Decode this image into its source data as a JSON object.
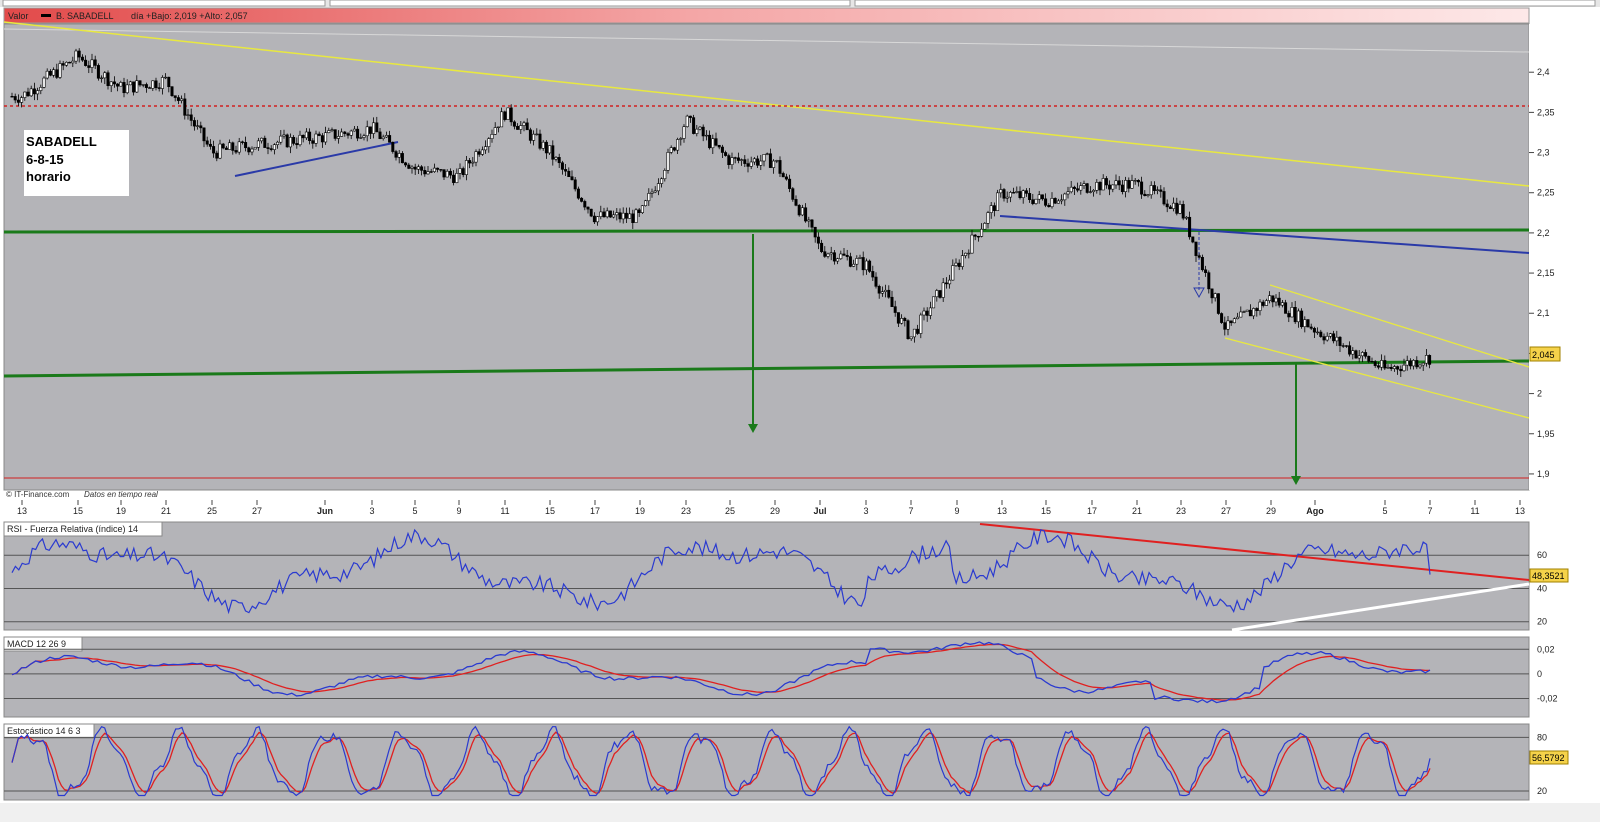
{
  "price_panel": {
    "header": {
      "series_label": "Valor",
      "instrument": "B. SABADELL",
      "stats": "día +Bajo: 2,019 +Alto: 2,057"
    },
    "annotation_lines": [
      "SABADELL",
      "6-8-15",
      "horario"
    ],
    "footer": {
      "source": "© IT-Finance.com",
      "realtime": "Datos en tiempo real"
    },
    "last_value_label": "2,045",
    "colors": {
      "background": "#b4b4b8",
      "candle": "#000000",
      "support": "#1a7a1a",
      "resistance": "#e8e840",
      "trend_blue": "#2a3aa8",
      "red_level": "#d22020"
    }
  },
  "x_axis": {
    "ticks": [
      "13",
      "15",
      "19",
      "21",
      "25",
      "27",
      "Jun",
      "3",
      "5",
      "9",
      "11",
      "15",
      "17",
      "19",
      "23",
      "25",
      "29",
      "Jul",
      "3",
      "7",
      "9",
      "13",
      "15",
      "17",
      "21",
      "23",
      "27",
      "29",
      "Ago",
      "5",
      "7",
      "11",
      "13"
    ]
  },
  "rsi_panel": {
    "title": "RSI - Fuerza Relativa (índice) 14",
    "last_value_label": "48,3521"
  },
  "macd_panel": {
    "title": "MACD 12 26 9"
  },
  "stoch_panel": {
    "title": "Estocástico 14 6 3",
    "last_value_label": "56,5792"
  },
  "chart_data": [
    {
      "type": "candlestick",
      "y_axis_ticks": [
        "1,9",
        "1,95",
        "2",
        "2,05",
        "2,1",
        "2,15",
        "2,2",
        "2,25",
        "2,3",
        "2,35",
        "2,4"
      ],
      "ylim": [
        1.88,
        2.46
      ],
      "approx_close_path": [
        {
          "x": "13",
          "y": 2.37
        },
        {
          "x": "15",
          "y": 2.42
        },
        {
          "x": "19",
          "y": 2.38
        },
        {
          "x": "21",
          "y": 2.39
        },
        {
          "x": "25",
          "y": 2.3
        },
        {
          "x": "27",
          "y": 2.31
        },
        {
          "x": "Jun",
          "y": 2.32
        },
        {
          "x": "3",
          "y": 2.33
        },
        {
          "x": "5",
          "y": 2.28
        },
        {
          "x": "9",
          "y": 2.27
        },
        {
          "x": "11",
          "y": 2.35
        },
        {
          "x": "15",
          "y": 2.3
        },
        {
          "x": "17",
          "y": 2.22
        },
        {
          "x": "19",
          "y": 2.22
        },
        {
          "x": "23",
          "y": 2.34
        },
        {
          "x": "25",
          "y": 2.29
        },
        {
          "x": "29",
          "y": 2.29
        },
        {
          "x": "Jul",
          "y": 2.18
        },
        {
          "x": "3",
          "y": 2.16
        },
        {
          "x": "7",
          "y": 2.07
        },
        {
          "x": "9",
          "y": 2.16
        },
        {
          "x": "13",
          "y": 2.25
        },
        {
          "x": "15",
          "y": 2.24
        },
        {
          "x": "17",
          "y": 2.26
        },
        {
          "x": "21",
          "y": 2.26
        },
        {
          "x": "23",
          "y": 2.23
        },
        {
          "x": "27",
          "y": 2.08
        },
        {
          "x": "29",
          "y": 2.12
        },
        {
          "x": "Ago",
          "y": 2.08
        },
        {
          "x": "5",
          "y": 2.03
        },
        {
          "x": "7",
          "y": 2.045
        }
      ],
      "last_value": 2.045,
      "lines": [
        {
          "name": "green-support-upper",
          "from": {
            "x": "13",
            "y": 2.2
          },
          "to": {
            "x": "13",
            "y": 2.2
          }
        },
        {
          "name": "green-support-lower",
          "from": {
            "x": "13",
            "y": 2.02
          },
          "to": {
            "x": "13",
            "y": 2.04
          }
        },
        {
          "name": "red-level",
          "y": 2.35
        }
      ]
    },
    {
      "type": "line",
      "name": "RSI",
      "y_axis_ticks": [
        "20",
        "40",
        "60"
      ],
      "ylim": [
        15,
        80
      ],
      "last_value": 48.3521
    },
    {
      "type": "line",
      "name": "MACD",
      "y_axis_ticks": [
        "-0,02",
        "0",
        "0,02"
      ],
      "ylim": [
        -0.035,
        0.03
      ]
    },
    {
      "type": "line",
      "name": "Stochastic",
      "y_axis_ticks": [
        "20",
        "80"
      ],
      "ylim": [
        10,
        95
      ],
      "last_value": 56.5792
    }
  ]
}
